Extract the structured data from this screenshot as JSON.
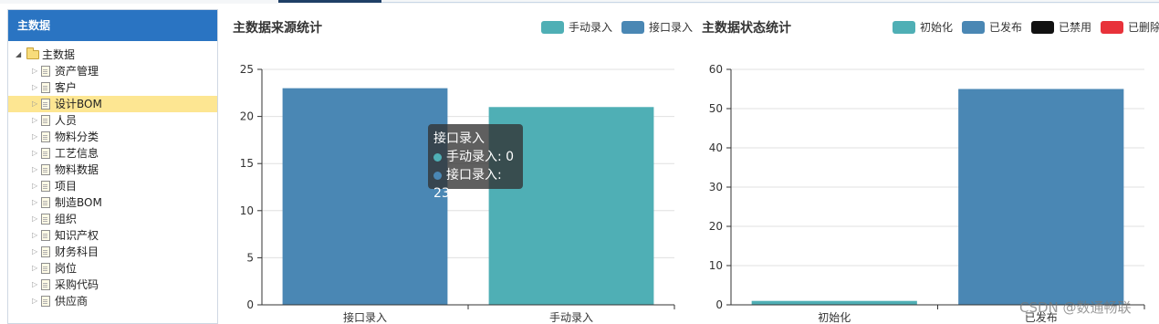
{
  "sidebar": {
    "title": "主数据",
    "root_label": "主数据",
    "items": [
      {
        "label": "资产管理"
      },
      {
        "label": "客户"
      },
      {
        "label": "设计BOM",
        "selected": true
      },
      {
        "label": "人员"
      },
      {
        "label": "物料分类"
      },
      {
        "label": "工艺信息"
      },
      {
        "label": "物料数据"
      },
      {
        "label": "项目"
      },
      {
        "label": "制造BOM"
      },
      {
        "label": "组织"
      },
      {
        "label": "知识产权"
      },
      {
        "label": "财务科目"
      },
      {
        "label": "岗位"
      },
      {
        "label": "采购代码"
      },
      {
        "label": "供应商"
      }
    ]
  },
  "colors": {
    "teal": "#4fafb5",
    "steel_blue": "#4a87b4",
    "black": "#111111",
    "red": "#e8323a",
    "header_blue": "#2a74c2",
    "selected_bg": "#fde692"
  },
  "chart_data": [
    {
      "type": "bar",
      "title": "主数据来源统计",
      "legend": [
        {
          "name": "手动录入",
          "color": "#4fafb5"
        },
        {
          "name": "接口录入",
          "color": "#4a87b4"
        }
      ],
      "legend_position": "top-right",
      "categories": [
        "接口录入",
        "手动录入"
      ],
      "series": [
        {
          "name": "手动录入",
          "values": [
            0,
            21
          ]
        },
        {
          "name": "接口录入",
          "values": [
            23,
            0
          ]
        }
      ],
      "ylim": [
        0,
        25
      ],
      "yticks": [
        0,
        5,
        10,
        15,
        20,
        25
      ],
      "grid": true
    },
    {
      "type": "bar",
      "title": "主数据状态统计",
      "legend": [
        {
          "name": "初始化",
          "color": "#4fafb5"
        },
        {
          "name": "已发布",
          "color": "#4a87b4"
        },
        {
          "name": "已禁用",
          "color": "#111111"
        },
        {
          "name": "已删除",
          "color": "#e8323a"
        }
      ],
      "legend_position": "top-right",
      "categories": [
        "初始化",
        "已发布"
      ],
      "series": [
        {
          "name": "初始化",
          "values": [
            1,
            0
          ]
        },
        {
          "name": "已发布",
          "values": [
            0,
            55
          ]
        },
        {
          "name": "已禁用",
          "values": [
            0,
            0
          ]
        },
        {
          "name": "已删除",
          "values": [
            0,
            0
          ]
        }
      ],
      "ylim": [
        0,
        60
      ],
      "yticks": [
        0,
        10,
        20,
        30,
        40,
        50,
        60
      ],
      "grid": true
    }
  ],
  "tooltip": {
    "title": "接口录入",
    "rows": [
      {
        "label": "手动录入: 0",
        "color": "#4fafb5"
      },
      {
        "label": "接口录入: 23",
        "color": "#4a87b4"
      }
    ]
  },
  "watermark": "CSDN @数通畅联"
}
